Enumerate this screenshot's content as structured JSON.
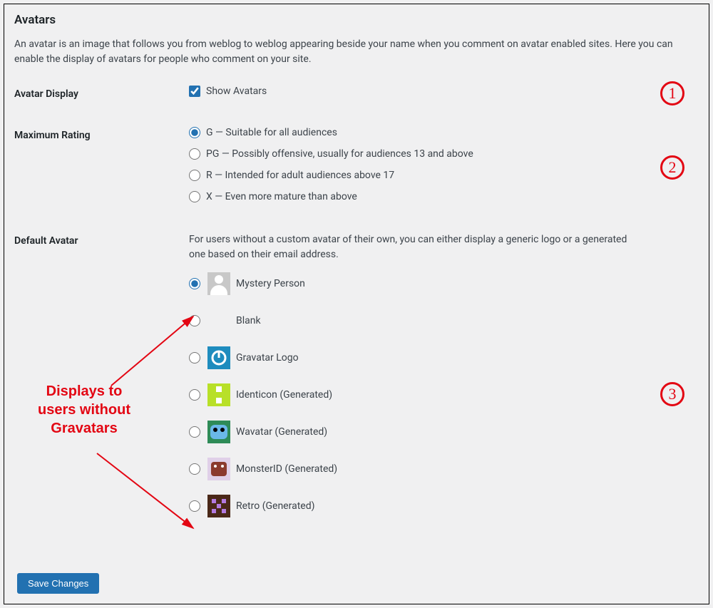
{
  "heading": "Avatars",
  "description": "An avatar is an image that follows you from weblog to weblog appearing beside your name when you comment on avatar enabled sites. Here you can enable the display of avatars for people who comment on your site.",
  "rows": {
    "avatar_display": {
      "label": "Avatar Display",
      "checkbox_label": "Show Avatars",
      "checked": true
    },
    "maximum_rating": {
      "label": "Maximum Rating",
      "options": [
        "G — Suitable for all audiences",
        "PG — Possibly offensive, usually for audiences 13 and above",
        "R — Intended for adult audiences above 17",
        "X — Even more mature than above"
      ],
      "selected": 0
    },
    "default_avatar": {
      "label": "Default Avatar",
      "helper": "For users without a custom avatar of their own, you can either display a generic logo or a generated one based on their email address.",
      "options": [
        "Mystery Person",
        "Blank",
        "Gravatar Logo",
        "Identicon (Generated)",
        "Wavatar (Generated)",
        "MonsterID (Generated)",
        "Retro (Generated)"
      ],
      "selected": 0
    }
  },
  "badges": [
    "1",
    "2",
    "3"
  ],
  "annotation_text": "Displays to users without Gravatars",
  "save_label": "Save Changes"
}
